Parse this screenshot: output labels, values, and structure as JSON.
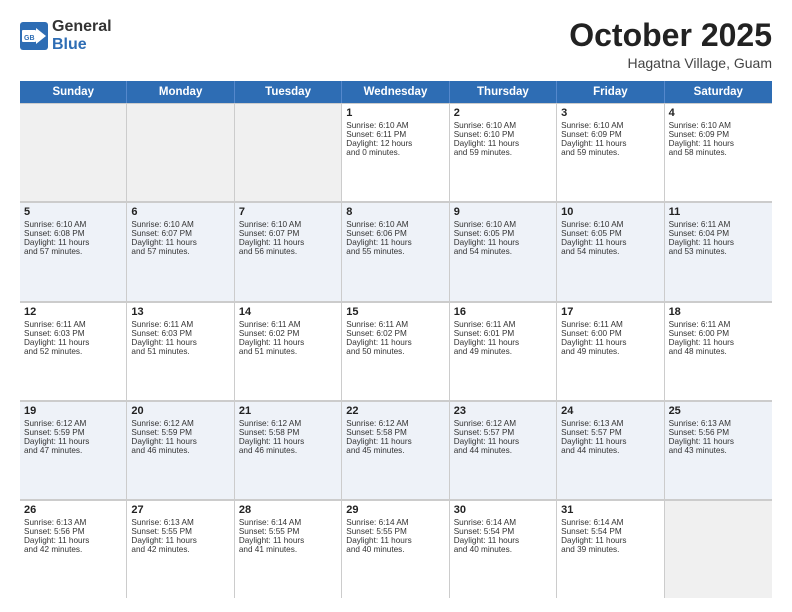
{
  "logo": {
    "general": "General",
    "blue": "Blue"
  },
  "title": "October 2025",
  "location": "Hagatna Village, Guam",
  "weekdays": [
    "Sunday",
    "Monday",
    "Tuesday",
    "Wednesday",
    "Thursday",
    "Friday",
    "Saturday"
  ],
  "weeks": [
    [
      {
        "day": "",
        "info": ""
      },
      {
        "day": "",
        "info": ""
      },
      {
        "day": "",
        "info": ""
      },
      {
        "day": "1",
        "info": "Sunrise: 6:10 AM\nSunset: 6:11 PM\nDaylight: 12 hours\nand 0 minutes."
      },
      {
        "day": "2",
        "info": "Sunrise: 6:10 AM\nSunset: 6:10 PM\nDaylight: 11 hours\nand 59 minutes."
      },
      {
        "day": "3",
        "info": "Sunrise: 6:10 AM\nSunset: 6:09 PM\nDaylight: 11 hours\nand 59 minutes."
      },
      {
        "day": "4",
        "info": "Sunrise: 6:10 AM\nSunset: 6:09 PM\nDaylight: 11 hours\nand 58 minutes."
      }
    ],
    [
      {
        "day": "5",
        "info": "Sunrise: 6:10 AM\nSunset: 6:08 PM\nDaylight: 11 hours\nand 57 minutes."
      },
      {
        "day": "6",
        "info": "Sunrise: 6:10 AM\nSunset: 6:07 PM\nDaylight: 11 hours\nand 57 minutes."
      },
      {
        "day": "7",
        "info": "Sunrise: 6:10 AM\nSunset: 6:07 PM\nDaylight: 11 hours\nand 56 minutes."
      },
      {
        "day": "8",
        "info": "Sunrise: 6:10 AM\nSunset: 6:06 PM\nDaylight: 11 hours\nand 55 minutes."
      },
      {
        "day": "9",
        "info": "Sunrise: 6:10 AM\nSunset: 6:05 PM\nDaylight: 11 hours\nand 54 minutes."
      },
      {
        "day": "10",
        "info": "Sunrise: 6:10 AM\nSunset: 6:05 PM\nDaylight: 11 hours\nand 54 minutes."
      },
      {
        "day": "11",
        "info": "Sunrise: 6:11 AM\nSunset: 6:04 PM\nDaylight: 11 hours\nand 53 minutes."
      }
    ],
    [
      {
        "day": "12",
        "info": "Sunrise: 6:11 AM\nSunset: 6:03 PM\nDaylight: 11 hours\nand 52 minutes."
      },
      {
        "day": "13",
        "info": "Sunrise: 6:11 AM\nSunset: 6:03 PM\nDaylight: 11 hours\nand 51 minutes."
      },
      {
        "day": "14",
        "info": "Sunrise: 6:11 AM\nSunset: 6:02 PM\nDaylight: 11 hours\nand 51 minutes."
      },
      {
        "day": "15",
        "info": "Sunrise: 6:11 AM\nSunset: 6:02 PM\nDaylight: 11 hours\nand 50 minutes."
      },
      {
        "day": "16",
        "info": "Sunrise: 6:11 AM\nSunset: 6:01 PM\nDaylight: 11 hours\nand 49 minutes."
      },
      {
        "day": "17",
        "info": "Sunrise: 6:11 AM\nSunset: 6:00 PM\nDaylight: 11 hours\nand 49 minutes."
      },
      {
        "day": "18",
        "info": "Sunrise: 6:11 AM\nSunset: 6:00 PM\nDaylight: 11 hours\nand 48 minutes."
      }
    ],
    [
      {
        "day": "19",
        "info": "Sunrise: 6:12 AM\nSunset: 5:59 PM\nDaylight: 11 hours\nand 47 minutes."
      },
      {
        "day": "20",
        "info": "Sunrise: 6:12 AM\nSunset: 5:59 PM\nDaylight: 11 hours\nand 46 minutes."
      },
      {
        "day": "21",
        "info": "Sunrise: 6:12 AM\nSunset: 5:58 PM\nDaylight: 11 hours\nand 46 minutes."
      },
      {
        "day": "22",
        "info": "Sunrise: 6:12 AM\nSunset: 5:58 PM\nDaylight: 11 hours\nand 45 minutes."
      },
      {
        "day": "23",
        "info": "Sunrise: 6:12 AM\nSunset: 5:57 PM\nDaylight: 11 hours\nand 44 minutes."
      },
      {
        "day": "24",
        "info": "Sunrise: 6:13 AM\nSunset: 5:57 PM\nDaylight: 11 hours\nand 44 minutes."
      },
      {
        "day": "25",
        "info": "Sunrise: 6:13 AM\nSunset: 5:56 PM\nDaylight: 11 hours\nand 43 minutes."
      }
    ],
    [
      {
        "day": "26",
        "info": "Sunrise: 6:13 AM\nSunset: 5:56 PM\nDaylight: 11 hours\nand 42 minutes."
      },
      {
        "day": "27",
        "info": "Sunrise: 6:13 AM\nSunset: 5:55 PM\nDaylight: 11 hours\nand 42 minutes."
      },
      {
        "day": "28",
        "info": "Sunrise: 6:14 AM\nSunset: 5:55 PM\nDaylight: 11 hours\nand 41 minutes."
      },
      {
        "day": "29",
        "info": "Sunrise: 6:14 AM\nSunset: 5:55 PM\nDaylight: 11 hours\nand 40 minutes."
      },
      {
        "day": "30",
        "info": "Sunrise: 6:14 AM\nSunset: 5:54 PM\nDaylight: 11 hours\nand 40 minutes."
      },
      {
        "day": "31",
        "info": "Sunrise: 6:14 AM\nSunset: 5:54 PM\nDaylight: 11 hours\nand 39 minutes."
      },
      {
        "day": "",
        "info": ""
      }
    ]
  ]
}
